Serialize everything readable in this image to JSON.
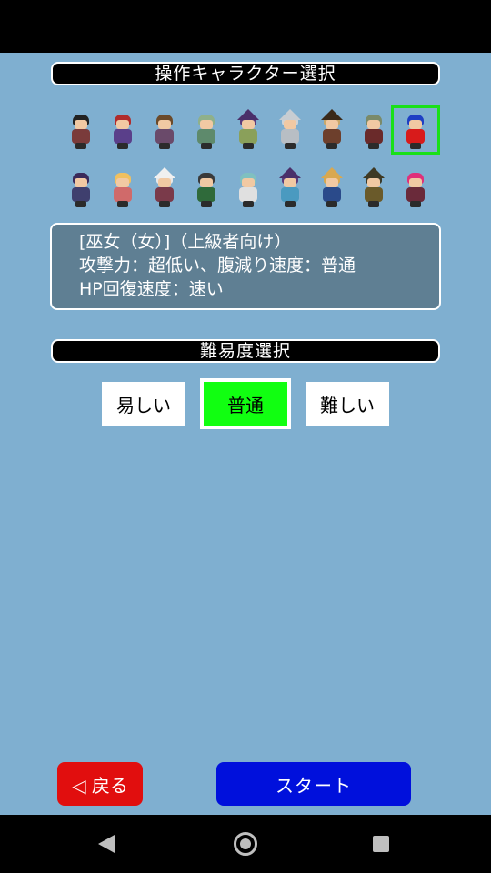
{
  "character_section": {
    "title": "操作キャラクター選択"
  },
  "characters": {
    "row1": [
      {
        "icon": "spiky-hair-warrior-sprite",
        "hair": "#222222",
        "body": "#7a3b3b",
        "hat": ""
      },
      {
        "icon": "red-bandana-fighter-sprite",
        "hair": "#b02c2c",
        "body": "#5a3f8a",
        "hat": ""
      },
      {
        "icon": "brown-hair-woman-sprite",
        "hair": "#6b4a2a",
        "body": "#6a4a6a",
        "hat": ""
      },
      {
        "icon": "green-cat-person-sprite",
        "hair": "#8fb08a",
        "body": "#5e8a6c",
        "hat": ""
      },
      {
        "icon": "purple-hat-witch-sprite",
        "hair": "#5b3a7a",
        "body": "#8aa05a",
        "hat": "#4a2f6a"
      },
      {
        "icon": "armored-knight-sprite",
        "hair": "#cfd3d6",
        "body": "#b8bec4",
        "hat": "#c8cdd2"
      },
      {
        "icon": "pirate-captain-sprite",
        "hair": "#caa86a",
        "body": "#6d3f2c",
        "hat": "#3a2a1a"
      },
      {
        "icon": "old-green-man-sprite",
        "hair": "#7a8a6a",
        "body": "#6a2a2a",
        "hat": ""
      },
      {
        "icon": "blue-hair-shrine-maiden-sprite",
        "hair": "#1e3fc4",
        "body": "#d81b1b",
        "hat": ""
      }
    ],
    "row2": [
      {
        "icon": "dark-purple-man-sprite",
        "hair": "#3a2a5a",
        "body": "#3f3f6e",
        "hat": ""
      },
      {
        "icon": "blonde-girl-sprite",
        "hair": "#f0c060",
        "body": "#d06a6a",
        "hat": ""
      },
      {
        "icon": "white-hood-nun-sprite",
        "hair": "#e8e8e8",
        "body": "#7a3a4a",
        "hat": "#f0f0f0"
      },
      {
        "icon": "green-cloak-rogue-sprite",
        "hair": "#3a3a3a",
        "body": "#2f6a3a",
        "hat": ""
      },
      {
        "icon": "pink-hair-maid-sprite",
        "hair": "#7fc0c0",
        "body": "#e0e0e0",
        "hat": ""
      },
      {
        "icon": "purple-hat-mage-sprite",
        "hair": "#5b3a7a",
        "body": "#4a9ac0",
        "hat": "#4a2f6a"
      },
      {
        "icon": "straw-hat-farmer-sprite",
        "hair": "#d8a850",
        "body": "#2a4a8a",
        "hat": "#d8a850"
      },
      {
        "icon": "dark-hat-sorcerer-sprite",
        "hair": "#3a3a2a",
        "body": "#6a5a2a",
        "hat": "#3f3a24"
      },
      {
        "icon": "pink-hair-girl-sprite",
        "hair": "#e0307a",
        "body": "#6a2a3a",
        "hat": ""
      }
    ],
    "selected": "blue-hair-shrine-maiden-sprite"
  },
  "description": {
    "line1": "[巫女（女）]（上級者向け）",
    "line2": "攻撃力：超低い、腹減り速度：普通",
    "line3": "HP回復速度：速い"
  },
  "difficulty_section": {
    "title": "難易度選択"
  },
  "difficulty": {
    "easy": "易しい",
    "normal": "普通",
    "hard": "難しい",
    "selected": "normal"
  },
  "buttons": {
    "back": "◁ 戻る",
    "start": "スタート"
  },
  "colors": {
    "background": "#7fafd0",
    "selection": "#19e019",
    "back": "#e10e0e",
    "start": "#0010dc",
    "difficulty_active": "#11ff11"
  }
}
